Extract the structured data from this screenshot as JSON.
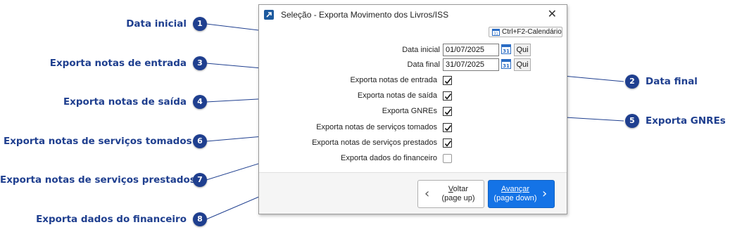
{
  "dialog": {
    "title": "Seleção - Exporta Movimento dos Livros/ISS",
    "close_symbol": "✕",
    "calendar_shortcut_label": "Ctrl+F2-Calendário",
    "fields": {
      "data_inicial": {
        "label": "Data inicial",
        "value": "01/07/2025",
        "day": "Qui"
      },
      "data_final": {
        "label": "Data final",
        "value": "31/07/2025",
        "day": "Qui"
      }
    },
    "checkboxes": [
      {
        "label": "Exporta notas de entrada",
        "checked": true
      },
      {
        "label": "Exporta notas de saída",
        "checked": true
      },
      {
        "label": "Exporta GNREs",
        "checked": true
      },
      {
        "label": "Exporta notas de serviços tomados",
        "checked": true
      },
      {
        "label": "Exporta notas de serviços prestados",
        "checked": true
      },
      {
        "label": "Exporta dados do financeiro",
        "checked": false
      }
    ],
    "buttons": {
      "back": {
        "line1_underlined": "V",
        "line1_rest": "oltar",
        "line2": "(page up)"
      },
      "next": {
        "line1_pre": "Avan",
        "line1_underlined": "ç",
        "line1_rest": "ar",
        "line2": "(page down)"
      }
    }
  },
  "callouts": [
    {
      "number": "1",
      "text": "Data inicial"
    },
    {
      "number": "2",
      "text": "Data final"
    },
    {
      "number": "3",
      "text": "Exporta notas de entrada"
    },
    {
      "number": "4",
      "text": "Exporta notas de saída"
    },
    {
      "number": "5",
      "text": "Exporta GNREs"
    },
    {
      "number": "6",
      "text": "Exporta notas de serviços tomados"
    },
    {
      "number": "7",
      "text": "Exporta notas de serviços prestados"
    },
    {
      "number": "8",
      "text": "Exporta dados do financeiro"
    }
  ],
  "colors": {
    "callout_blue": "#1f3f8f",
    "primary_button": "#1473e6",
    "calendar_icon": "#2a6cc4"
  },
  "icons": [
    "app-icon",
    "close-icon",
    "calendar-icon",
    "checkmark-icon",
    "chevron-left-icon",
    "chevron-right-icon"
  ]
}
